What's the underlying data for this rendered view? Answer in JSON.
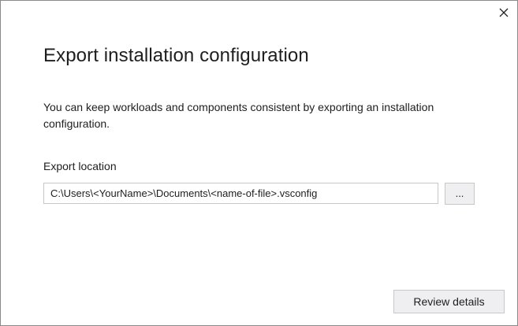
{
  "dialog": {
    "title": "Export installation configuration",
    "description": "You can keep workloads and components consistent by exporting an installation configuration.",
    "close_icon": "close-icon"
  },
  "export_location": {
    "label": "Export location",
    "value": "C:\\Users\\<YourName>\\Documents\\<name-of-file>.vsconfig",
    "browse_label": "..."
  },
  "footer": {
    "review_label": "Review details"
  }
}
